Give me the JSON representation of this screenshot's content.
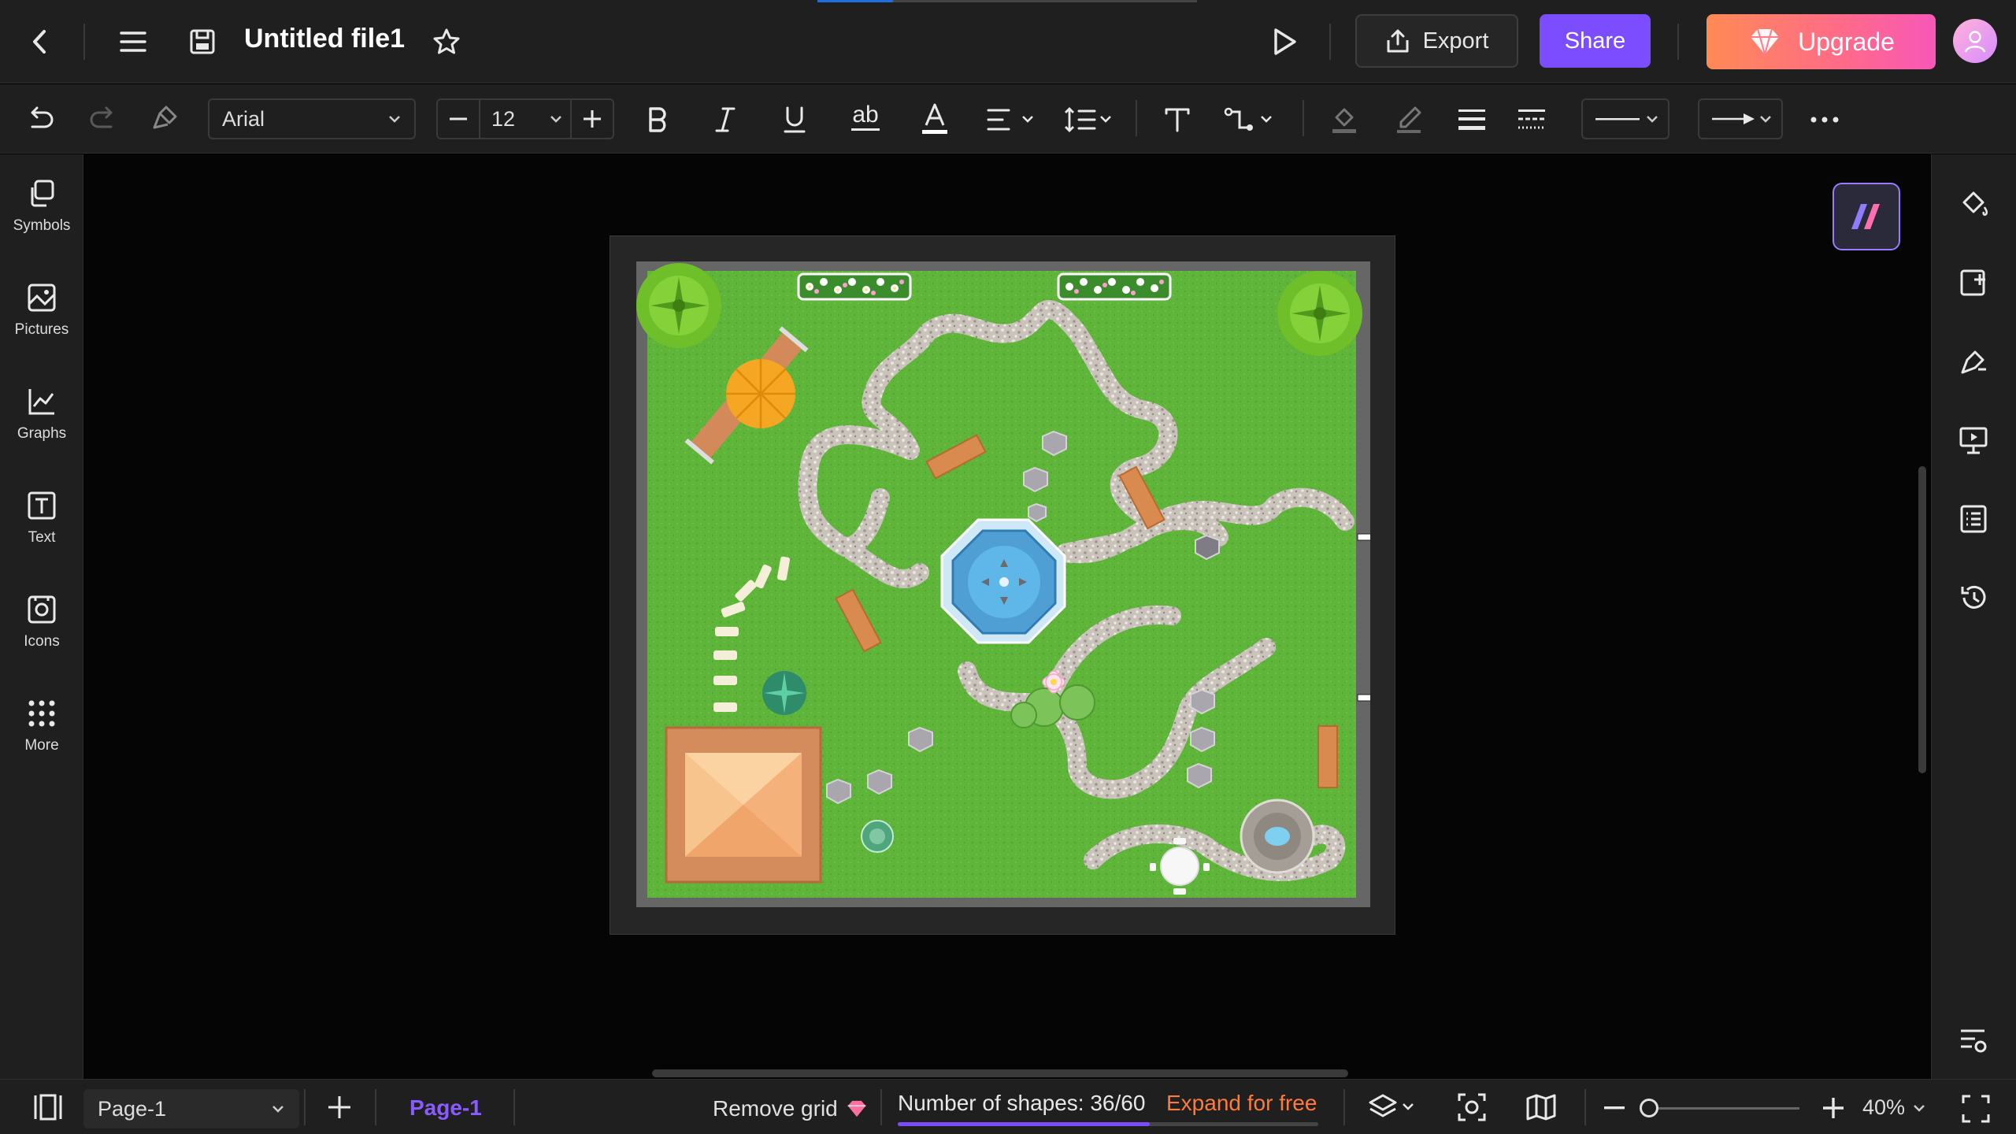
{
  "header": {
    "title": "Untitled file1",
    "export_label": "Export",
    "share_label": "Share",
    "upgrade_label": "Upgrade"
  },
  "toolbar": {
    "font_family": "Arial",
    "font_size": "12",
    "strike_label": "ab"
  },
  "left_panel": {
    "items": [
      {
        "label": "Symbols",
        "icon": "symbols-icon"
      },
      {
        "label": "Pictures",
        "icon": "pictures-icon"
      },
      {
        "label": "Graphs",
        "icon": "graphs-icon"
      },
      {
        "label": "Text",
        "icon": "text-icon"
      },
      {
        "label": "Icons",
        "icon": "icons-icon"
      },
      {
        "label": "More",
        "icon": "more-icon"
      }
    ]
  },
  "right_panel": {
    "icons": [
      "fill-icon",
      "page-setup-icon",
      "theme-icon",
      "presentation-icon",
      "outline-icon",
      "history-icon",
      "settings-list-icon"
    ]
  },
  "status": {
    "page_select": "Page-1",
    "page_tab": "Page-1",
    "remove_grid": "Remove grid",
    "shapes_count": "Number of shapes: 36/60",
    "shapes_used": 36,
    "shapes_max": 60,
    "expand_label": "Expand for free",
    "zoom": "40%",
    "zoom_level": 0.4
  },
  "colors": {
    "accent_purple": "#7c4dff",
    "upgrade_orange": "#ff7a3d",
    "lawn_green": "#5fb43a",
    "water_blue": "#4fb0e6"
  }
}
